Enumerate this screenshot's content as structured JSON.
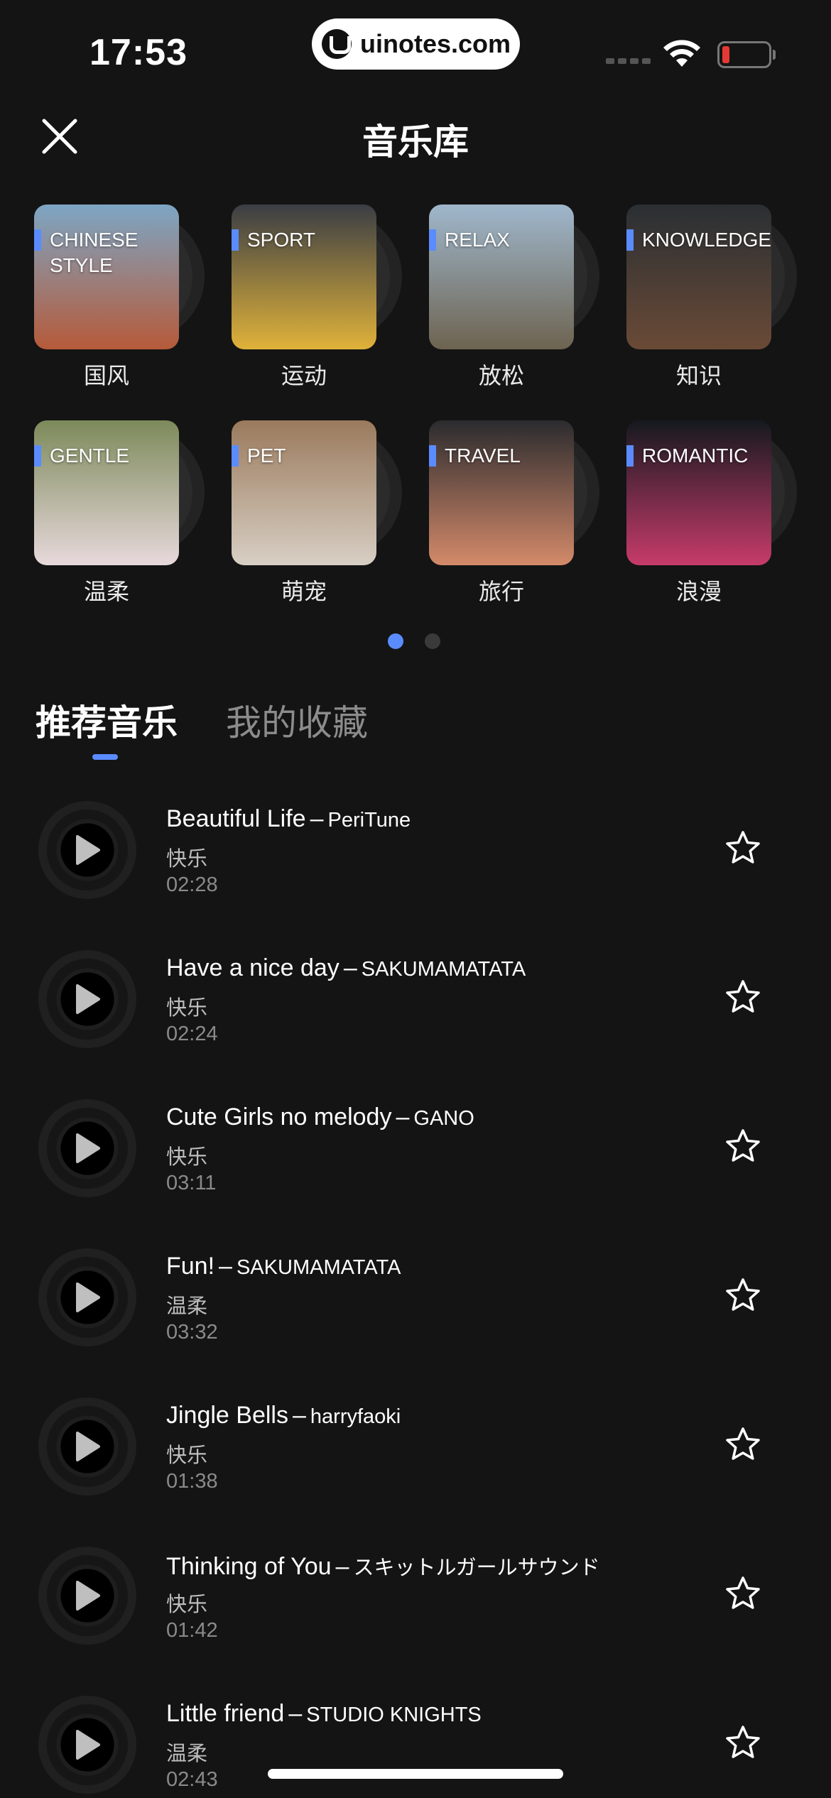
{
  "status_bar": {
    "time": "17:53",
    "url": "uinotes.com"
  },
  "header": {
    "title": "音乐库",
    "close_icon": "close-icon"
  },
  "categories": [
    {
      "tag": "CHINESE STYLE",
      "label": "国风",
      "colors": [
        "#7da6c4",
        "#b65a3a"
      ]
    },
    {
      "tag": "SPORT",
      "label": "运动",
      "colors": [
        "#3a3d44",
        "#e0b23a"
      ]
    },
    {
      "tag": "RELAX",
      "label": "放松",
      "colors": [
        "#9fb7cc",
        "#6d6350"
      ]
    },
    {
      "tag": "KNOWLEDGE",
      "label": "知识",
      "colors": [
        "#2a2f33",
        "#6a4a36"
      ]
    },
    {
      "tag": "GENTLE",
      "label": "温柔",
      "colors": [
        "#7c8a5a",
        "#e8d9dc"
      ]
    },
    {
      "tag": "PET",
      "label": "萌宠",
      "colors": [
        "#9a7a5c",
        "#d8cfc4"
      ]
    },
    {
      "tag": "TRAVEL",
      "label": "旅行",
      "colors": [
        "#2b2b2e",
        "#d48a6a"
      ]
    },
    {
      "tag": "ROMANTIC",
      "label": "浪漫",
      "colors": [
        "#15191f",
        "#c73b6a"
      ]
    }
  ],
  "pager": {
    "pages": 2,
    "active": 1
  },
  "tabs": [
    {
      "label": "推荐音乐",
      "active": true
    },
    {
      "label": "我的收藏",
      "active": false
    }
  ],
  "tracks": [
    {
      "title": "Beautiful Life",
      "artist": "PeriTune",
      "genre": "快乐",
      "duration": "02:28"
    },
    {
      "title": "Have a nice day",
      "artist": "SAKUMAMATATA",
      "genre": "快乐",
      "duration": "02:24"
    },
    {
      "title": "Cute Girls no melody",
      "artist": "GANO",
      "genre": "快乐",
      "duration": "03:11"
    },
    {
      "title": "Fun!",
      "artist": "SAKUMAMATATA",
      "genre": "温柔",
      "duration": "03:32"
    },
    {
      "title": "Jingle Bells",
      "artist": "harryfaoki",
      "genre": "快乐",
      "duration": "01:38"
    },
    {
      "title": "Thinking of You",
      "artist": "スキットルガールサウンド",
      "genre": "快乐",
      "duration": "01:42"
    },
    {
      "title": "Little friend",
      "artist": "STUDIO KNIGHTS",
      "genre": "温柔",
      "duration": "02:43"
    }
  ],
  "separator": "–",
  "colors": {
    "background": "#141414",
    "accent": "#5b8cff",
    "battery_low": "#e53935"
  }
}
